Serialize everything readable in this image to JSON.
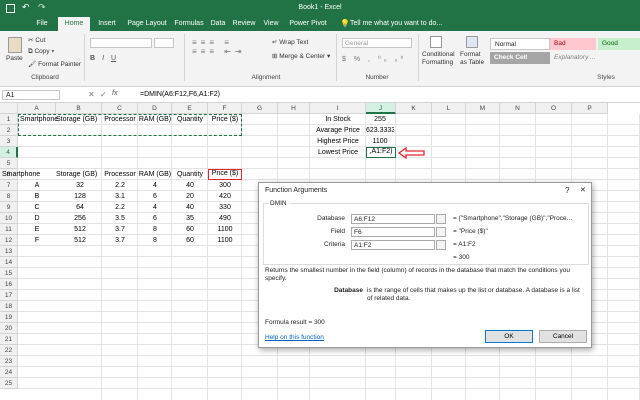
{
  "title_bar": {
    "title": "Book1 - Excel"
  },
  "tabs": [
    "File",
    "Home",
    "Insert",
    "Page Layout",
    "Formulas",
    "Data",
    "Review",
    "View",
    "Power Pivot"
  ],
  "tell_me": "Tell me what you want to do...",
  "ribbon": {
    "paste": "Paste",
    "cut": "Cut",
    "copy": "Copy",
    "format_painter": "Format Painter",
    "clipboard": "Clipboard",
    "wrap_text": "Wrap Text",
    "merge_center": "Merge & Center",
    "alignment": "Alignment",
    "number_format": "General",
    "number": "Number",
    "conditional_formatting": "Conditional Formatting",
    "format_as_table": "Format as Table",
    "styles": "Styles",
    "style_normal": "Normal",
    "style_bad": "Bad",
    "style_good": "Good",
    "style_check_cell": "Check Cell",
    "style_explanatory": "Explanatory ..."
  },
  "formula_bar": {
    "name_box": "A1",
    "formula": "=DMIN(A6:F12,F6,A1:F2)"
  },
  "columns": [
    "A",
    "B",
    "C",
    "D",
    "E",
    "F",
    "G",
    "H",
    "I",
    "J",
    "K",
    "L",
    "M",
    "N",
    "O",
    "P"
  ],
  "rows": [
    "1",
    "2",
    "3",
    "4",
    "5",
    "6",
    "7",
    "8",
    "9",
    "10",
    "11",
    "12",
    "13",
    "14",
    "15",
    "16",
    "17",
    "18",
    "19",
    "20",
    "21",
    "22",
    "23",
    "24",
    "25"
  ],
  "criteria_headers": [
    "Smartphone",
    "Storage (GB)",
    "Processor",
    "RAM (GB)",
    "Quantity",
    "Price ($)"
  ],
  "table_headers": [
    "Smartphone",
    "Storage (GB)",
    "Processor",
    "RAM (GB)",
    "Quantity",
    "Price ($)"
  ],
  "table_rows": [
    [
      "A",
      "32",
      "2.2",
      "4",
      "40",
      "300"
    ],
    [
      "B",
      "128",
      "3.1",
      "6",
      "20",
      "420"
    ],
    [
      "C",
      "64",
      "2.2",
      "4",
      "40",
      "330"
    ],
    [
      "D",
      "256",
      "3.5",
      "6",
      "35",
      "490"
    ],
    [
      "E",
      "512",
      "3.7",
      "8",
      "60",
      "1100"
    ],
    [
      "F",
      "512",
      "3.7",
      "8",
      "60",
      "1100"
    ]
  ],
  "stats": [
    {
      "label": "In Stock",
      "value": "255"
    },
    {
      "label": "Avarage Price",
      "value": "623.3333"
    },
    {
      "label": "Highest Price",
      "value": "1100"
    },
    {
      "label": "Lowest Price",
      "value": ",A1:F2)"
    }
  ],
  "dialog": {
    "title": "Function Arguments",
    "help_mark": "?",
    "close": "✕",
    "function_name": "DMIN",
    "args": [
      {
        "label": "Database",
        "value": "A6:F12",
        "result": "= {\"Smartphone\",\"Storage (GB)\",\"Proce..."
      },
      {
        "label": "Field",
        "value": "F6",
        "result": "= \"Price ($)\""
      },
      {
        "label": "Criteria",
        "value": "A1:F2",
        "result": "= A1:F2"
      }
    ],
    "result_line": "= 300",
    "description": "Returns the smallest number in the field (column) of records in the database that match the conditions you specify.",
    "arg_name": "Database",
    "arg_desc": "is the range of cells that makes up the list or database. A database is a list of related data.",
    "formula_result": "Formula result =   300",
    "help_link": "Help on this function",
    "ok": "OK",
    "cancel": "Cancel"
  },
  "colors": {
    "excel_green": "#217346",
    "red": "#e3262c"
  }
}
